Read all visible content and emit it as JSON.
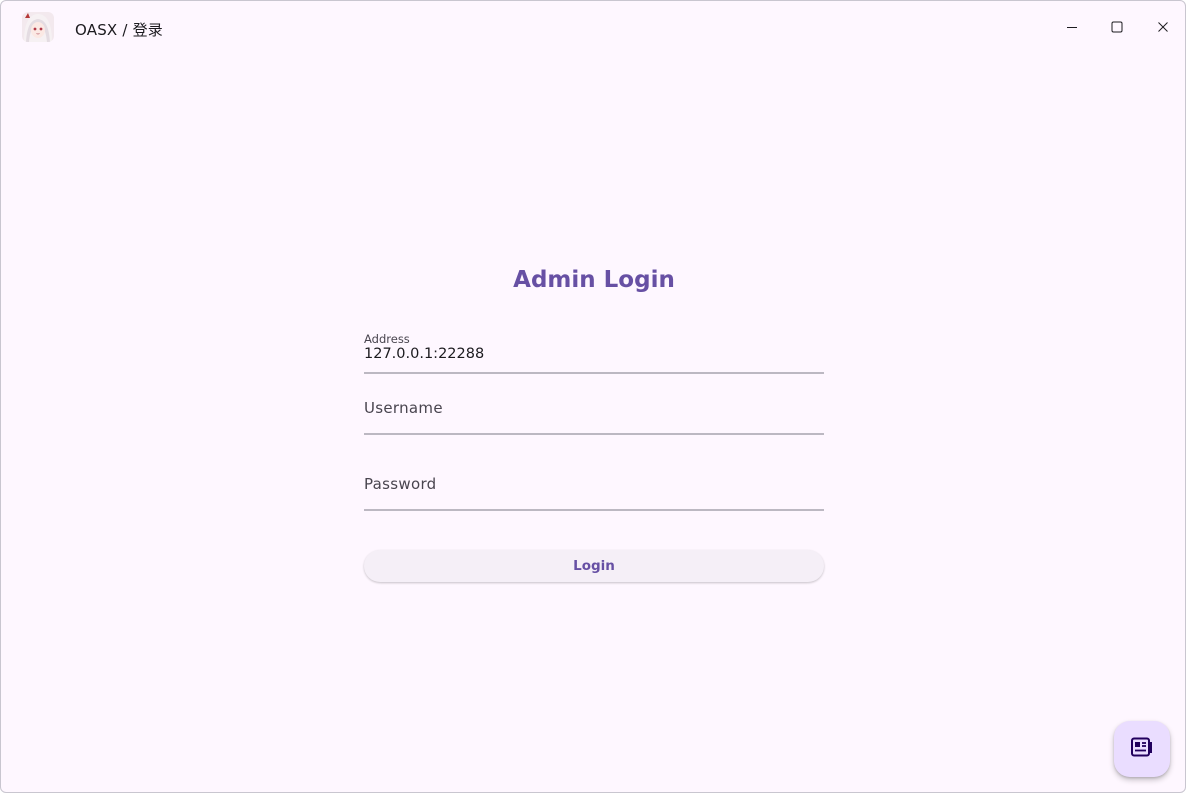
{
  "window": {
    "title": "OASX / 登录"
  },
  "titlebar_controls": {
    "minimize_icon": "minimize-icon",
    "maximize_icon": "maximize-icon",
    "close_icon": "close-icon"
  },
  "login": {
    "heading": "Admin Login",
    "address": {
      "label": "Address",
      "value": "127.0.0.1:22288"
    },
    "username": {
      "label": "Username",
      "value": ""
    },
    "password": {
      "label": "Password",
      "value": ""
    },
    "submit_label": "Login"
  },
  "fab": {
    "icon": "newspaper-icon"
  },
  "colors": {
    "accent": "#6750a4",
    "background": "#fef7ff",
    "fab_background": "#eaddff",
    "button_background": "#f5eff7"
  }
}
